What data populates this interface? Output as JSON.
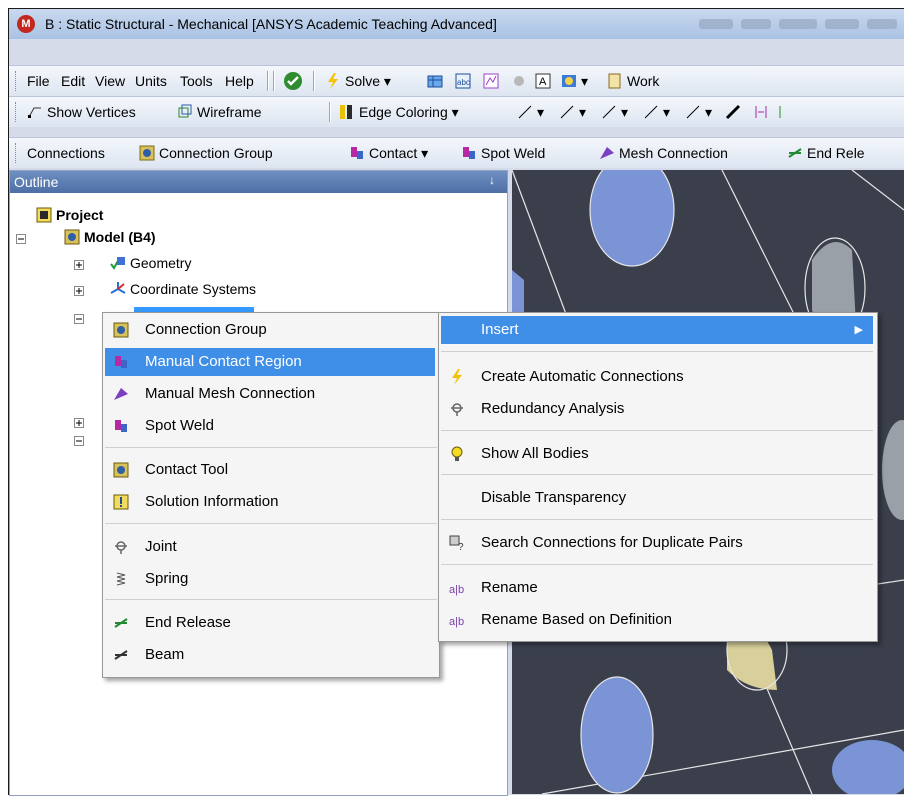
{
  "window": {
    "title": "B : Static Structural - Mechanical [ANSYS Academic Teaching Advanced]",
    "app_icon_letter": "M"
  },
  "menubar": {
    "items": [
      "File",
      "Edit",
      "View",
      "Units",
      "Tools",
      "Help"
    ],
    "solve_label": "Solve",
    "worksheet_label": "Work"
  },
  "graphics_toolbar": {
    "show_vertices": "Show Vertices",
    "wireframe": "Wireframe",
    "edge_coloring": "Edge Coloring"
  },
  "context_toolbar": {
    "connections": "Connections",
    "connection_group": "Connection Group",
    "contact": "Contact",
    "spot_weld": "Spot Weld",
    "mesh_connection": "Mesh Connection",
    "end_release": "End Rele"
  },
  "outline": {
    "title": "Outline",
    "pin_glyph": "↓",
    "project": "Project",
    "model": "Model (B4)",
    "geometry": "Geometry",
    "coordinate_systems": "Coordinate Systems"
  },
  "context_menu": {
    "insert": "Insert",
    "items": [
      "Create Automatic Connections",
      "Redundancy Analysis",
      "Show All Bodies",
      "Disable Transparency",
      "Search Connections for Duplicate Pairs",
      "Rename",
      "Rename Based on Definition"
    ]
  },
  "insert_submenu": {
    "items": [
      "Connection Group",
      "Manual Contact Region",
      "Manual Mesh Connection",
      "Spot Weld",
      "Contact Tool",
      "Solution Information",
      "Joint",
      "Spring",
      "End Release",
      "Beam"
    ],
    "highlighted": "Manual Contact Region"
  },
  "colors": {
    "highlight": "#3399ff",
    "viewport": "#3a3f4b",
    "panel_header": "#5877ad",
    "ellipse_fill": "#7b94d6"
  }
}
